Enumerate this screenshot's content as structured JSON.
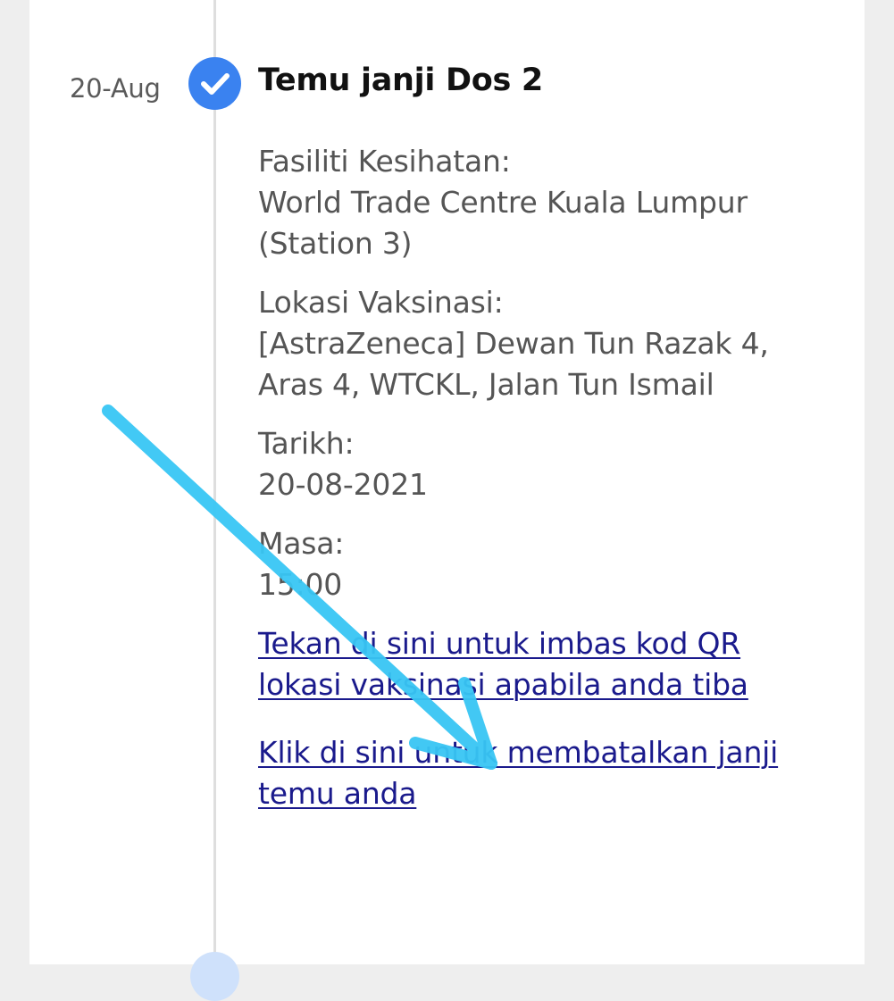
{
  "timeline": {
    "entry": {
      "date": "20-Aug",
      "title": "Temu janji Dos 2",
      "status_icon": "check-circle-icon",
      "facility_label": "Fasiliti Kesihatan:",
      "facility_value": "World Trade Centre Kuala Lumpur (Station 3)",
      "location_label": "Lokasi Vaksinasi:",
      "location_value": "[AstraZeneca] Dewan Tun Razak 4, Aras 4, WTCKL, Jalan Tun Ismail",
      "date_label": "Tarikh:",
      "date_value": "20-08-2021",
      "time_label": "Masa:",
      "time_value": "15:00",
      "scan_qr_link": "Tekan di sini untuk imbas kod QR lokasi vaksinasi apabila anda tiba",
      "cancel_link": "Klik di sini untuk membatalkan janji temu anda"
    }
  },
  "colors": {
    "check_blue": "#3a82f0",
    "link": "#1a1a8c",
    "annotation_arrow": "#38c6f4"
  }
}
